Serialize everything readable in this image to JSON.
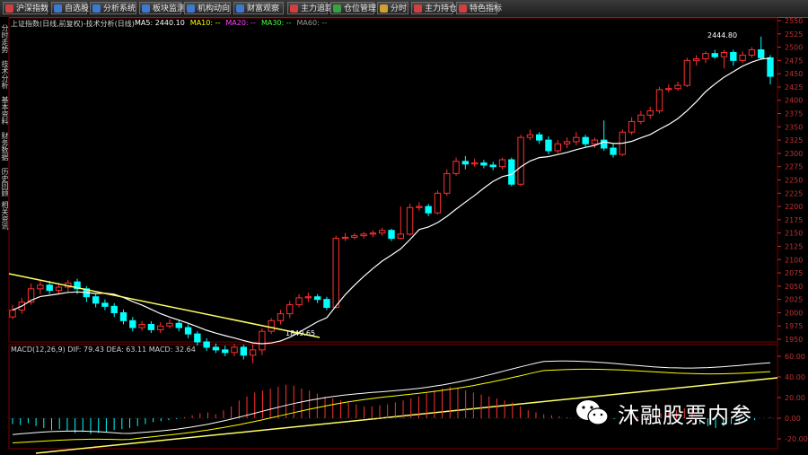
{
  "toolbar": {
    "buttons": [
      {
        "label": "沪深指数",
        "icon": "chart-icon",
        "color": "#d04040"
      },
      {
        "label": "自选股",
        "icon": "list-icon",
        "color": "#3b7ad0"
      },
      {
        "label": "分析系统",
        "icon": "globe-icon",
        "color": "#3b7ad0"
      },
      {
        "label": "板块监测",
        "icon": "grid-icon",
        "color": "#3b7ad0"
      },
      {
        "label": "机构动向",
        "icon": "people-icon",
        "color": "#3b7ad0"
      },
      {
        "label": "财富观察",
        "icon": "chart-icon",
        "color": "#3b7ad0"
      },
      {
        "label": "主力追踪",
        "icon": "target-icon",
        "color": "#d04040"
      },
      {
        "label": "仓位管理",
        "icon": "check-icon",
        "color": "#3ba040"
      },
      {
        "label": "分时",
        "icon": "bars-icon",
        "color": "#d0a030"
      },
      {
        "label": "主力持仓",
        "icon": "bars-icon",
        "color": "#d04040"
      },
      {
        "label": "特色指标",
        "icon": "star-icon",
        "color": "#d04040"
      }
    ]
  },
  "sidebar": {
    "tabs": [
      "分时走势",
      "技术分析",
      "基本资料",
      "财务数据",
      "历史回顾",
      "相关资讯"
    ]
  },
  "main_panel": {
    "title": "上证指数(日线,前复权)-技术分析(日线)",
    "ma_labels": [
      {
        "text": "MA5: 2440.10",
        "color": "#ffffff"
      },
      {
        "text": "MA10: --",
        "color": "#ffff00"
      },
      {
        "text": "MA20: --",
        "color": "#ff44ff"
      },
      {
        "text": "MA30: --",
        "color": "#44ff44"
      },
      {
        "text": "MA60: --",
        "color": "#999999"
      }
    ],
    "high_label": "2444.80",
    "low_label": "1849.65",
    "y_ticks": [
      "2550",
      "2525",
      "2500",
      "2475",
      "2450",
      "2425",
      "2400",
      "2375",
      "2350",
      "2325",
      "2300",
      "2275",
      "2250",
      "2225",
      "2200",
      "2175",
      "2150",
      "2125",
      "2100",
      "2075",
      "2050",
      "2025",
      "2000",
      "1975",
      "1950"
    ]
  },
  "macd_panel": {
    "title": "MACD(12,26,9) DIF: 79.43 DEA: 63.11 MACD: 32.64",
    "y_ticks": [
      "60.00",
      "40.00",
      "20.00",
      "0.00",
      "-20.00"
    ]
  },
  "watermark": {
    "text": "沐融股票内参",
    "icon": "wechat-icon"
  },
  "colors": {
    "up": "#ff3030",
    "down": "#00ffff",
    "ma": "#ffffff",
    "trendline": "#ffff66",
    "grid": "#7a0000",
    "axis_text": "#c03030"
  },
  "chart_data": {
    "type": "candlestick",
    "ylim": [
      1945,
      2555
    ],
    "trendlines_visible": true,
    "candles": [
      [
        1992,
        2005,
        2015,
        1988
      ],
      [
        2005,
        2020,
        2028,
        1998
      ],
      [
        2020,
        2045,
        2055,
        2015
      ],
      [
        2045,
        2052,
        2062,
        2035
      ],
      [
        2052,
        2042,
        2060,
        2035
      ],
      [
        2042,
        2048,
        2056,
        2035
      ],
      [
        2048,
        2056,
        2062,
        2040
      ],
      [
        2058,
        2045,
        2064,
        2035
      ],
      [
        2045,
        2030,
        2050,
        2020
      ],
      [
        2030,
        2018,
        2035,
        2010
      ],
      [
        2018,
        2012,
        2025,
        2005
      ],
      [
        2012,
        2000,
        2018,
        1992
      ],
      [
        2000,
        1985,
        2006,
        1978
      ],
      [
        1985,
        1972,
        1992,
        1965
      ],
      [
        1972,
        1978,
        1984,
        1966
      ],
      [
        1978,
        1968,
        1984,
        1962
      ],
      [
        1968,
        1975,
        1982,
        1962
      ],
      [
        1975,
        1980,
        1988,
        1970
      ],
      [
        1980,
        1972,
        1986,
        1965
      ],
      [
        1972,
        1960,
        1978,
        1952
      ],
      [
        1960,
        1945,
        1965,
        1938
      ],
      [
        1945,
        1935,
        1952,
        1928
      ],
      [
        1935,
        1930,
        1942,
        1924
      ],
      [
        1930,
        1925,
        1938,
        1918
      ],
      [
        1925,
        1935,
        1942,
        1918
      ],
      [
        1935,
        1920,
        1940,
        1912
      ],
      [
        1920,
        1930,
        1940,
        1905
      ],
      [
        1930,
        1965,
        1970,
        1920
      ],
      [
        1965,
        1985,
        1990,
        1960
      ],
      [
        1985,
        1998,
        2005,
        1978
      ],
      [
        1998,
        2015,
        2022,
        1990
      ],
      [
        2015,
        2028,
        2035,
        2010
      ],
      [
        2028,
        2030,
        2038,
        2020
      ],
      [
        2030,
        2025,
        2035,
        2018
      ],
      [
        2025,
        2010,
        2030,
        2005
      ],
      [
        2010,
        2140,
        2145,
        2008
      ],
      [
        2140,
        2142,
        2150,
        2135
      ],
      [
        2142,
        2145,
        2150,
        2138
      ],
      [
        2145,
        2148,
        2152,
        2140
      ],
      [
        2148,
        2150,
        2155,
        2142
      ],
      [
        2150,
        2155,
        2160,
        2145
      ],
      [
        2155,
        2140,
        2158,
        2135
      ],
      [
        2140,
        2148,
        2200,
        2138
      ],
      [
        2148,
        2198,
        2205,
        2145
      ],
      [
        2198,
        2200,
        2208,
        2192
      ],
      [
        2200,
        2188,
        2205,
        2182
      ],
      [
        2188,
        2225,
        2230,
        2185
      ],
      [
        2225,
        2262,
        2270,
        2220
      ],
      [
        2262,
        2285,
        2292,
        2258
      ],
      [
        2285,
        2280,
        2295,
        2270
      ],
      [
        2280,
        2282,
        2290,
        2275
      ],
      [
        2282,
        2278,
        2288,
        2272
      ],
      [
        2278,
        2275,
        2284,
        2268
      ],
      [
        2275,
        2288,
        2292,
        2270
      ],
      [
        2288,
        2242,
        2292,
        2238
      ],
      [
        2242,
        2330,
        2335,
        2238
      ],
      [
        2330,
        2335,
        2345,
        2325
      ],
      [
        2335,
        2325,
        2340,
        2318
      ],
      [
        2325,
        2305,
        2332,
        2298
      ],
      [
        2305,
        2318,
        2325,
        2300
      ],
      [
        2318,
        2322,
        2330,
        2310
      ],
      [
        2322,
        2330,
        2340,
        2315
      ],
      [
        2330,
        2318,
        2335,
        2312
      ],
      [
        2318,
        2325,
        2330,
        2310
      ],
      [
        2325,
        2310,
        2362,
        2305
      ],
      [
        2310,
        2298,
        2318,
        2292
      ],
      [
        2298,
        2340,
        2345,
        2295
      ],
      [
        2340,
        2360,
        2368,
        2335
      ],
      [
        2360,
        2372,
        2380,
        2355
      ],
      [
        2372,
        2380,
        2388,
        2365
      ],
      [
        2380,
        2420,
        2425,
        2375
      ],
      [
        2420,
        2422,
        2430,
        2415
      ],
      [
        2422,
        2428,
        2435,
        2418
      ],
      [
        2428,
        2475,
        2480,
        2425
      ],
      [
        2475,
        2478,
        2485,
        2465
      ],
      [
        2478,
        2488,
        2492,
        2470
      ],
      [
        2488,
        2482,
        2495,
        2478
      ],
      [
        2482,
        2490,
        2495,
        2460
      ],
      [
        2490,
        2475,
        2495,
        2465
      ],
      [
        2475,
        2485,
        2492,
        2470
      ],
      [
        2485,
        2495,
        2500,
        2480
      ],
      [
        2495,
        2480,
        2520,
        2476
      ],
      [
        2480,
        2445,
        2485,
        2430
      ]
    ],
    "macd_hist": [
      -6,
      -7,
      -5,
      -8,
      -10,
      -12,
      -11,
      -13,
      -15,
      -14,
      -16,
      -15,
      -14,
      -12,
      -11,
      -10,
      -8,
      -6,
      -4,
      -3,
      -2,
      -1,
      1,
      3,
      5,
      6,
      4,
      8,
      12,
      18,
      22,
      26,
      28,
      30,
      32,
      34,
      33,
      30,
      28,
      25,
      22,
      20,
      18,
      16,
      14,
      12,
      12,
      13,
      14,
      16,
      18,
      20,
      22,
      25,
      28,
      30,
      32,
      30,
      28,
      26,
      24,
      22,
      20,
      18,
      16,
      12,
      8,
      6,
      4,
      3,
      2,
      1,
      0,
      -1,
      -2,
      -3,
      -2,
      -1,
      0,
      1,
      2,
      3,
      4,
      5,
      6,
      8,
      10,
      9,
      -6,
      -8,
      -10,
      -8,
      -6,
      -4,
      -3,
      -2,
      0,
      1
    ]
  }
}
